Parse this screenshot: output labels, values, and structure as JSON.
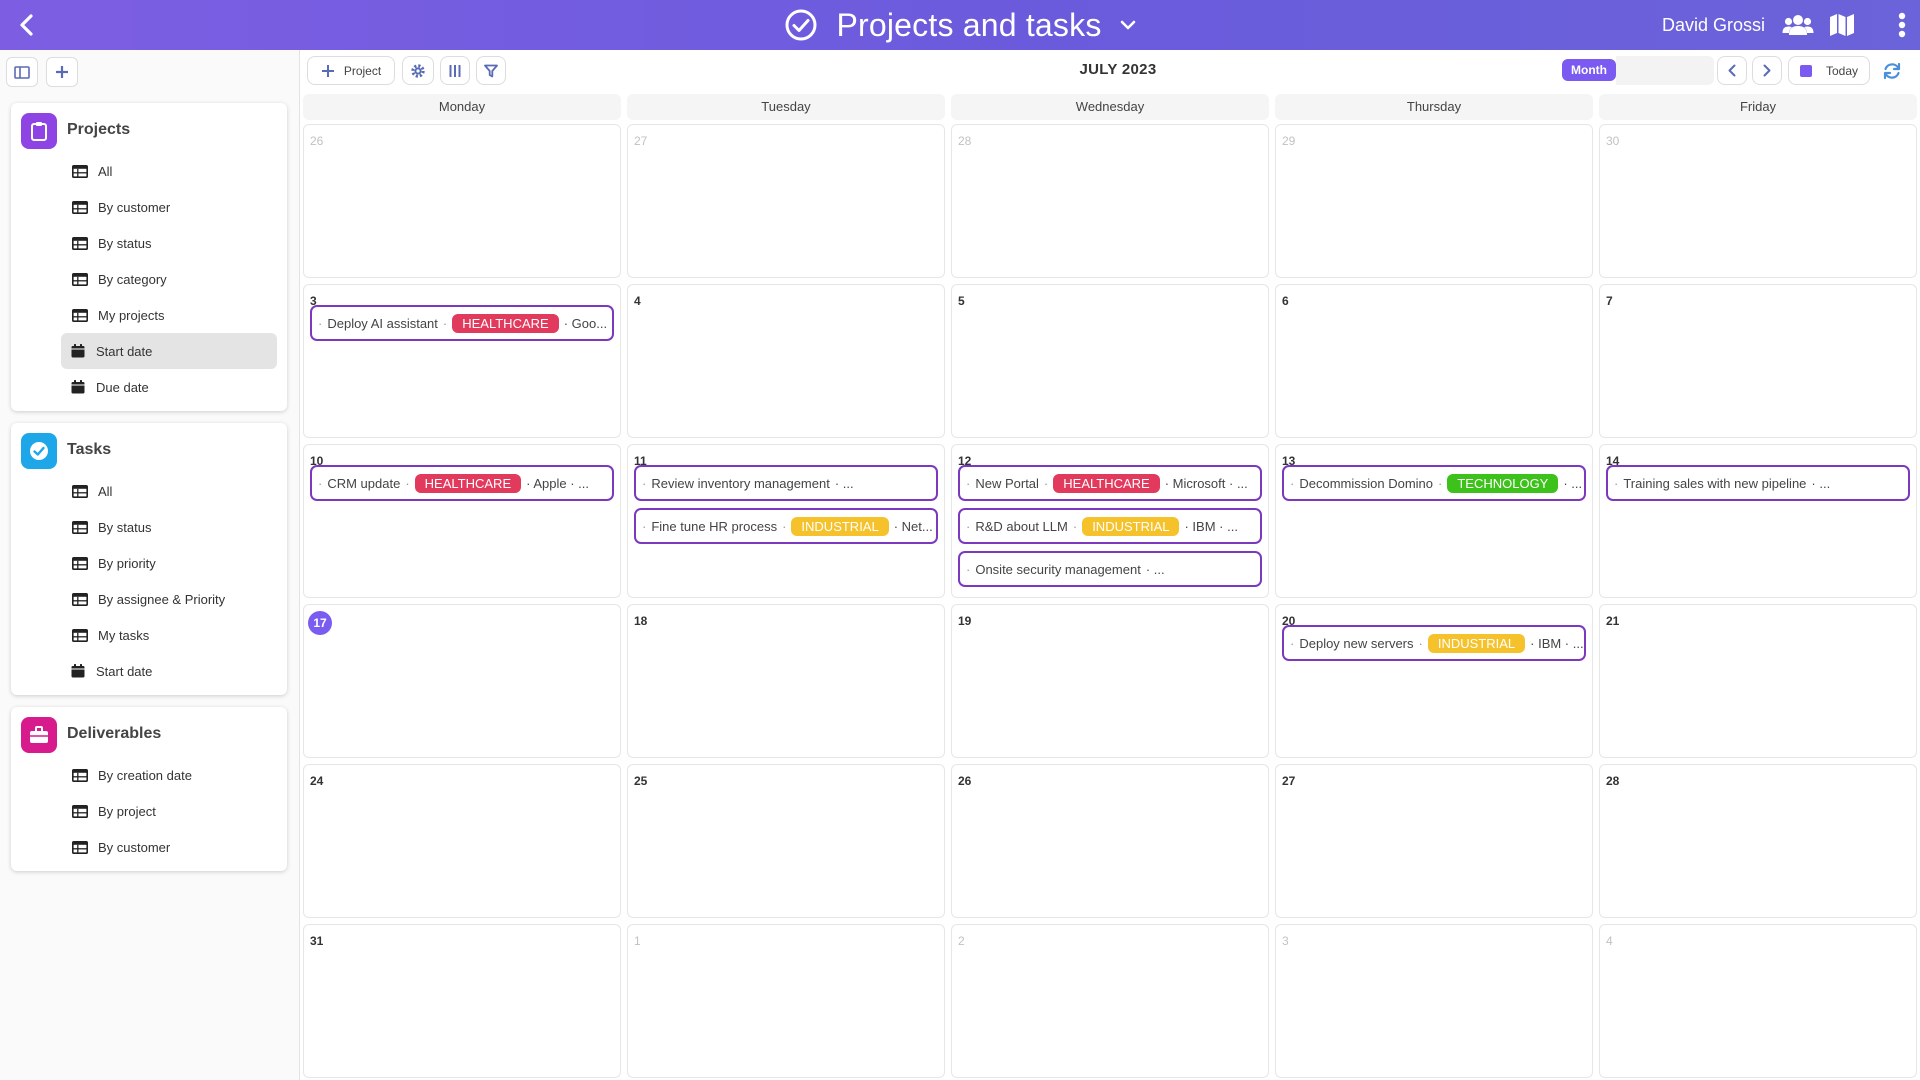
{
  "header": {
    "title": "Projects and tasks",
    "user": "David Grossi"
  },
  "sidebar": {
    "sections": [
      {
        "title": "Projects",
        "icon": "clipboard-icon",
        "color": "#8e44e5",
        "items": [
          {
            "label": "All",
            "icon": "table-icon"
          },
          {
            "label": "By customer",
            "icon": "table-icon"
          },
          {
            "label": "By status",
            "icon": "table-icon"
          },
          {
            "label": "By category",
            "icon": "table-icon"
          },
          {
            "label": "My projects",
            "icon": "table-icon"
          },
          {
            "label": "Start date",
            "icon": "calendar-icon",
            "active": true
          },
          {
            "label": "Due date",
            "icon": "calendar-icon"
          }
        ]
      },
      {
        "title": "Tasks",
        "icon": "check-circle-icon",
        "color": "#1ea7e8",
        "items": [
          {
            "label": "All",
            "icon": "table-icon"
          },
          {
            "label": "By status",
            "icon": "table-icon"
          },
          {
            "label": "By priority",
            "icon": "table-icon"
          },
          {
            "label": "By assignee & Priority",
            "icon": "table-icon"
          },
          {
            "label": "My tasks",
            "icon": "table-icon"
          },
          {
            "label": "Start date",
            "icon": "calendar-icon"
          }
        ]
      },
      {
        "title": "Deliverables",
        "icon": "briefcase-icon",
        "color": "#d81b8c",
        "items": [
          {
            "label": "By creation date",
            "icon": "table-icon"
          },
          {
            "label": "By project",
            "icon": "table-icon"
          },
          {
            "label": "By customer",
            "icon": "table-icon"
          }
        ]
      }
    ]
  },
  "toolbar": {
    "project_label": "Project",
    "month_title": "JULY 2023",
    "view_label": "Month",
    "today_label": "Today"
  },
  "calendar": {
    "weekdays": [
      "Monday",
      "Tuesday",
      "Wednesday",
      "Thursday",
      "Friday"
    ],
    "weeks": [
      [
        {
          "day": "26",
          "other": true
        },
        {
          "day": "27",
          "other": true
        },
        {
          "day": "28",
          "other": true
        },
        {
          "day": "29",
          "other": true
        },
        {
          "day": "30",
          "other": true
        }
      ],
      [
        {
          "day": "3"
        },
        {
          "day": "4"
        },
        {
          "day": "5"
        },
        {
          "day": "6"
        },
        {
          "day": "7"
        }
      ],
      [
        {
          "day": "10"
        },
        {
          "day": "11"
        },
        {
          "day": "12"
        },
        {
          "day": "13"
        },
        {
          "day": "14"
        }
      ],
      [
        {
          "day": "17",
          "today": true
        },
        {
          "day": "18"
        },
        {
          "day": "19"
        },
        {
          "day": "20"
        },
        {
          "day": "21"
        }
      ],
      [
        {
          "day": "24"
        },
        {
          "day": "25"
        },
        {
          "day": "26"
        },
        {
          "day": "27"
        },
        {
          "day": "28"
        }
      ],
      [
        {
          "day": "31"
        },
        {
          "day": "1",
          "other": true
        },
        {
          "day": "2",
          "other": true
        },
        {
          "day": "3",
          "other": true
        },
        {
          "day": "4",
          "other": true
        }
      ]
    ],
    "tag_colors": {
      "HEALTHCARE": "#e23a5c",
      "INDUSTRIAL": "#f6c22b",
      "TECHNOLOGY": "#3cc21a"
    },
    "events": [
      {
        "week": 1,
        "col": 0,
        "slot": 0,
        "name": "Deploy AI assistant",
        "tag": "HEALTHCARE",
        "tail": "· Goo..."
      },
      {
        "week": 2,
        "col": 0,
        "slot": 0,
        "name": "CRM update",
        "tag": "HEALTHCARE",
        "tail": "· Apple · ..."
      },
      {
        "week": 2,
        "col": 1,
        "slot": 0,
        "name": "Review inventory management",
        "tag": "",
        "tail": "· ..."
      },
      {
        "week": 2,
        "col": 1,
        "slot": 1,
        "name": "Fine tune HR process",
        "tag": "INDUSTRIAL",
        "tail": "· Net..."
      },
      {
        "week": 2,
        "col": 2,
        "slot": 0,
        "name": "New Portal",
        "tag": "HEALTHCARE",
        "tail": "· Microsoft · ..."
      },
      {
        "week": 2,
        "col": 2,
        "slot": 1,
        "name": "R&D about LLM",
        "tag": "INDUSTRIAL",
        "tail": "· IBM · ..."
      },
      {
        "week": 2,
        "col": 2,
        "slot": 2,
        "name": "Onsite security management",
        "tag": "",
        "tail": "· ..."
      },
      {
        "week": 2,
        "col": 3,
        "slot": 0,
        "name": "Decommission Domino",
        "tag": "TECHNOLOGY",
        "tail": "· ..."
      },
      {
        "week": 2,
        "col": 4,
        "slot": 0,
        "name": "Training sales with new pipeline",
        "tag": "",
        "tail": "· ..."
      },
      {
        "week": 3,
        "col": 3,
        "slot": 0,
        "name": "Deploy new servers",
        "tag": "INDUSTRIAL",
        "tail": "· IBM · ..."
      }
    ]
  }
}
